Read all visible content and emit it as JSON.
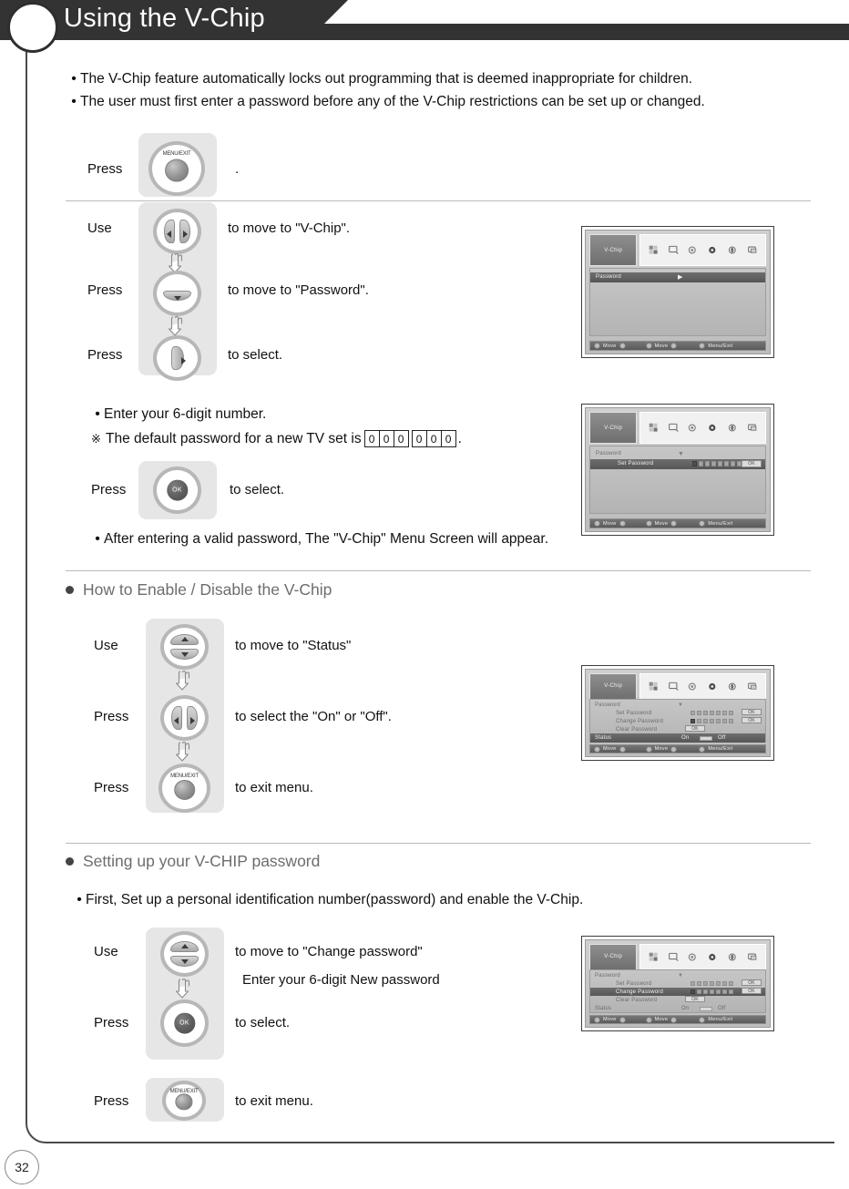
{
  "header": {
    "title": "Using the V-Chip",
    "page_number": "32"
  },
  "intro_bullets": [
    "The V-Chip feature automatically locks out programming that is deemed inappropriate for children.",
    "The user must first enter a password before any of the V-Chip restrictions can be set up or changed."
  ],
  "steps_block_1": [
    {
      "verb": "Press",
      "button": "menu-exit-button",
      "button_label": "MENU/EXIT",
      "desc": "."
    }
  ],
  "steps_block_2": [
    {
      "verb": "Use",
      "button": "left-right-button",
      "desc": "to move to \"V-Chip\"."
    },
    {
      "verb": "Press",
      "button": "down-button",
      "desc": "to move to \"Password\"."
    },
    {
      "verb": "Press",
      "button": "right-button",
      "desc": "to select."
    }
  ],
  "password_notes": {
    "bullet": "Enter your  6-digit number.",
    "note_prefix": "The default password for a new TV set is",
    "note_symbol": "※",
    "default_password": [
      "0",
      "0",
      "0",
      "0",
      "0",
      "0"
    ],
    "note_suffix": ".",
    "ok_step": {
      "verb": "Press",
      "button_label": "OK",
      "desc": "to select."
    },
    "after_bullet": "After entering a valid password, The \"V-Chip\" Menu Screen will appear."
  },
  "section_enable": {
    "title": "How to Enable / Disable the V-Chip",
    "steps": [
      {
        "verb": "Use",
        "button": "up-down-button",
        "desc": "to move to \"Status\""
      },
      {
        "verb": "Press",
        "button": "left-right-button",
        "desc": "to select the \"On\" or \"Off\"."
      },
      {
        "verb": "Press",
        "button": "menu-exit-button",
        "button_label": "MENU/EXIT",
        "desc": "to exit menu."
      }
    ]
  },
  "section_setup": {
    "title": "Setting up your V-CHIP password",
    "bullet": "First, Set up a personal identification number(password) and enable the V-Chip.",
    "steps": [
      {
        "verb": "Use",
        "button": "up-down-button",
        "desc": "to move to \"Change password\"",
        "desc2": "Enter your 6-digit New password"
      },
      {
        "verb": "Press",
        "button": "ok-button",
        "button_label": "OK",
        "desc": "to select."
      }
    ],
    "exit_step": {
      "verb": "Press",
      "button": "menu-exit-button",
      "button_label": "MENU/EXIT",
      "desc": "to exit menu."
    }
  },
  "osd_screens": [
    {
      "id": "osd-password-entry",
      "tab": "V-Chip",
      "rows": [
        {
          "label": "Password",
          "selected": true,
          "arrow": "▶",
          "indent": 0
        }
      ],
      "footer": {
        "move1": "Move",
        "move2": "Move",
        "exit": "Menu/Exit"
      }
    },
    {
      "id": "osd-set-password",
      "tab": "V-Chip",
      "rows": [
        {
          "label": "Password",
          "selected": false,
          "arrow": "▼",
          "indent": 0
        },
        {
          "label": "Set Password",
          "selected": true,
          "indent": 1,
          "dots": 8,
          "filled": 1,
          "ok": "OK"
        }
      ],
      "footer": {
        "move1": "Move",
        "move2": "Move",
        "exit": "Menu/Exit"
      }
    },
    {
      "id": "osd-status",
      "tab": "V-Chip",
      "rows": [
        {
          "label": "Password",
          "selected": false,
          "arrow": "▼",
          "indent": 0
        },
        {
          "label": "Set Password",
          "selected": false,
          "indent": 1,
          "dots": 7,
          "filled": 0,
          "ok": "OK"
        },
        {
          "label": "Change Password",
          "selected": false,
          "indent": 1,
          "dots": 7,
          "filled": 1,
          "ok": "OK"
        },
        {
          "label": "Clear Password",
          "selected": false,
          "indent": 1,
          "ok": "OK"
        },
        {
          "label": "Status",
          "selected": true,
          "indent": 0,
          "on": "On",
          "off": "Off"
        }
      ],
      "footer": {
        "move1": "Move",
        "move2": "Move",
        "exit": "Menu/Exit"
      }
    },
    {
      "id": "osd-change-password",
      "tab": "V-Chip",
      "rows": [
        {
          "label": "Password",
          "selected": false,
          "arrow": "▼",
          "indent": 0
        },
        {
          "label": "Set Password",
          "selected": false,
          "indent": 1,
          "dots": 7,
          "filled": 0,
          "ok": "OK"
        },
        {
          "label": "Change Password",
          "selected": true,
          "indent": 1,
          "dots": 7,
          "filled": 1,
          "ok": "OK"
        },
        {
          "label": "Clear Password",
          "selected": false,
          "indent": 1,
          "ok": "OK"
        },
        {
          "label": "Status",
          "selected": false,
          "indent": 0,
          "on": "On",
          "off": "Off"
        }
      ],
      "footer": {
        "move1": "Move",
        "move2": "Move",
        "exit": "Menu/Exit"
      }
    }
  ],
  "colors": {
    "header_band": "#333333",
    "heading_text": "#6d6d6d",
    "body_text": "#111111",
    "rule": "#b9b9b9",
    "pill": "#e6e6e6"
  }
}
